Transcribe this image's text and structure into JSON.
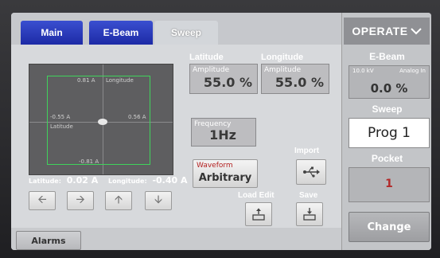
{
  "tabs": [
    {
      "label": "Main"
    },
    {
      "label": "E-Beam"
    },
    {
      "label": "Sweep"
    }
  ],
  "plot": {
    "top_label": "0.81 A",
    "top_axis": "Longitude",
    "left_label": "-0.55 A",
    "left_axis": "Latitude",
    "right_label": "0.56 A",
    "bottom_label": "-0.81 A"
  },
  "position": {
    "latitude_label": "Latitude:",
    "latitude_value": "0.02 A",
    "longitude_label": "Longitude:",
    "longitude_value": "-0.40 A"
  },
  "latitude": {
    "heading": "Latitude",
    "caption": "Amplitude",
    "value": "55.0 %"
  },
  "longitude": {
    "heading": "Longitude",
    "caption": "Amplitude",
    "value": "55.0 %"
  },
  "frequency": {
    "caption": "Frequency",
    "value": "1Hz"
  },
  "waveform": {
    "caption": "Waveform",
    "value": "Arbitrary"
  },
  "import_label": "Import",
  "load_edit_label": "Load Edit",
  "save_label": "Save",
  "alarms_label": "Alarms",
  "right": {
    "operate_label": "OPERATE",
    "ebeam_heading": "E-Beam",
    "ebeam_kv": "10.0 kV",
    "ebeam_mode": "Analog In",
    "ebeam_value": "0.0 %",
    "sweep_heading": "Sweep",
    "sweep_value": "Prog 1",
    "pocket_heading": "Pocket",
    "pocket_value": "1",
    "change_label": "Change"
  }
}
